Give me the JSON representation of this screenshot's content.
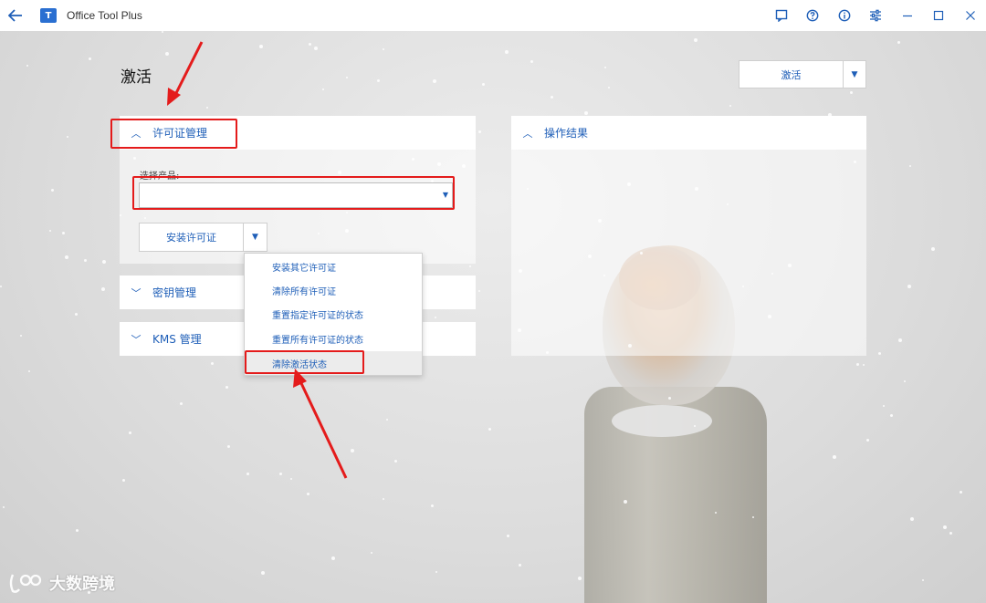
{
  "window": {
    "title": "Office Tool Plus",
    "logo_text": "T"
  },
  "titlebar_icons": [
    "back-arrow-icon",
    "feedback-icon",
    "help-icon",
    "info-icon",
    "settings-sliders-icon",
    "minimize-icon",
    "maximize-icon",
    "close-icon"
  ],
  "page": {
    "title": "激活",
    "activate_button_label": "激活"
  },
  "license_panel": {
    "title": "许可证管理",
    "select_product_label": "选择产品:",
    "select_product_value": "",
    "install_button_label": "安装许可证",
    "menu_items": [
      "安装其它许可证",
      "清除所有许可证",
      "重置指定许可证的状态",
      "重置所有许可证的状态",
      "清除激活状态"
    ]
  },
  "key_panel": {
    "title": "密钥管理"
  },
  "kms_panel": {
    "title": "KMS 管理"
  },
  "result_panel": {
    "title": "操作结果"
  },
  "watermark": {
    "text": "大数跨境"
  },
  "colors": {
    "accent": "#1f5fb8",
    "annotation_red": "#e41b1b"
  }
}
